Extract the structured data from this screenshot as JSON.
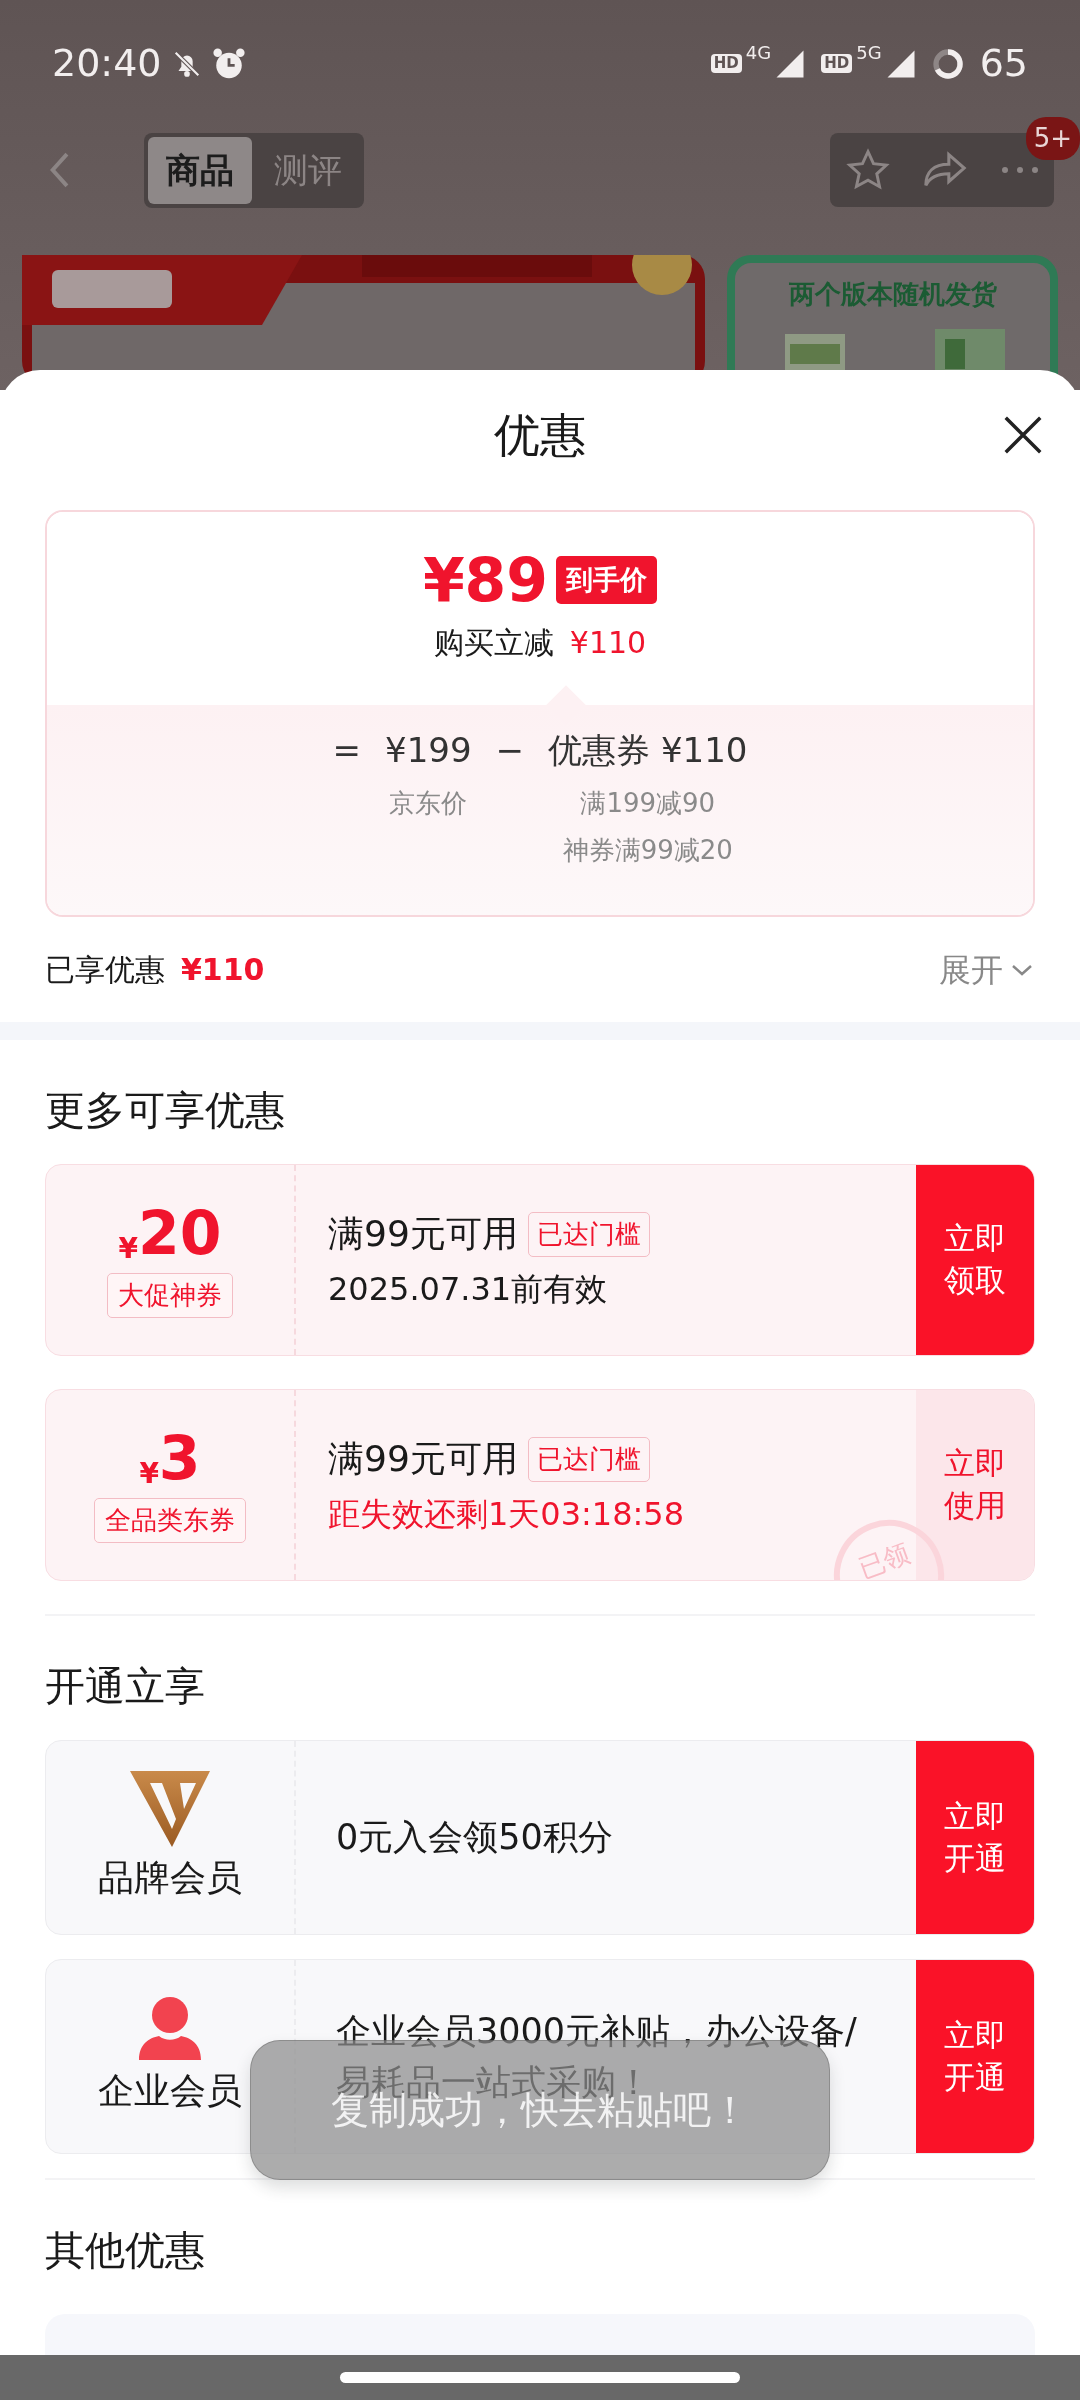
{
  "status_bar": {
    "time": "20:40",
    "signals": [
      {
        "hd": "HD",
        "network": "4G"
      },
      {
        "hd": "HD",
        "network": "5G"
      }
    ],
    "battery": "65"
  },
  "nav": {
    "tabs": [
      {
        "label": "商品",
        "selected": true
      },
      {
        "label": "测评",
        "selected": false
      }
    ],
    "badge": "5+"
  },
  "product_preview": {
    "note": "两个版本随机发货"
  },
  "sheet": {
    "title": "优惠",
    "price_card": {
      "final_price": "¥89",
      "price_tag": "到手价",
      "reduction_label": "购买立减",
      "reduction": "¥110",
      "equals": "=",
      "base_price": "¥199",
      "base_label": "京东价",
      "minus": "−",
      "coupon_total": "优惠券 ¥110",
      "coupon_details": [
        "满199减90",
        "神券满99减20"
      ]
    },
    "enjoyed": {
      "label": "已享优惠",
      "amount": "¥110",
      "expand": "展开"
    },
    "coupon_section": {
      "title": "更多可享优惠",
      "coupons": [
        {
          "currency": "¥",
          "amount": "20",
          "tag": "大促神券",
          "condition": "满99元可用",
          "badge": "已达门槛",
          "validity": "2025.07.31前有效",
          "kind": "date",
          "claimed": false,
          "action": "立即领取"
        },
        {
          "currency": "¥",
          "amount": "3",
          "tag": "全品类东券",
          "condition": "满99元可用",
          "badge": "已达门槛",
          "validity": "距失效还剩1天03:18:58",
          "kind": "countdown",
          "claimed": true,
          "stamp": "已领",
          "action": "立即使用"
        }
      ]
    },
    "member_section": {
      "title": "开通立享",
      "members": [
        {
          "kind": "brand",
          "name": "品牌会员",
          "description": "0元入会领50积分",
          "action": "立即开通"
        },
        {
          "kind": "enterprise",
          "name": "企业会员",
          "description": "企业会员3000元补贴，办公设备/易耗品一站式采购！",
          "action": "立即开通"
        }
      ]
    },
    "other_section": {
      "title": "其他优惠"
    }
  },
  "toast": "复制成功，快去粘贴吧！"
}
